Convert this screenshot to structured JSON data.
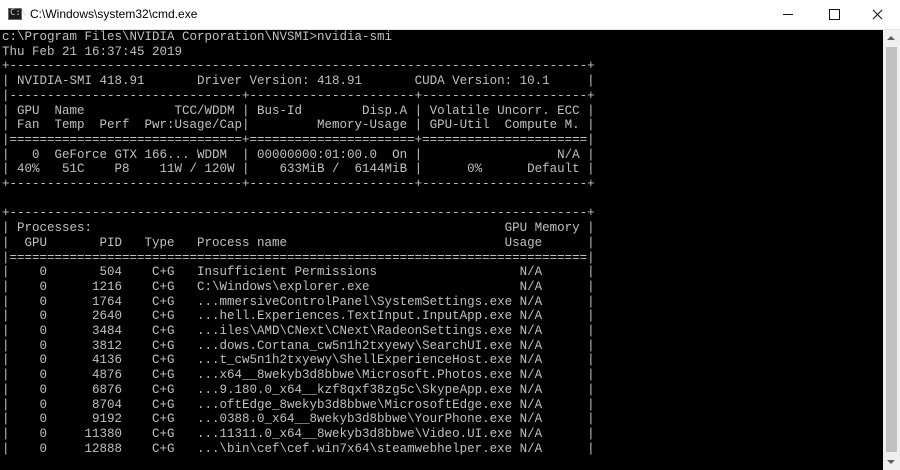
{
  "window": {
    "title": "C:\\Windows\\system32\\cmd.exe",
    "app_icon_glyph": "C:\\",
    "controls": [
      "minimize-icon",
      "maximize-icon",
      "close-icon"
    ]
  },
  "console": {
    "lines": [
      "c:\\Program Files\\NVIDIA Corporation\\NVSMI>nvidia-smi",
      "Thu Feb 21 16:37:45 2019",
      "+-----------------------------------------------------------------------------+",
      "| NVIDIA-SMI 418.91       Driver Version: 418.91       CUDA Version: 10.1     |",
      "|-------------------------------+----------------------+----------------------+",
      "| GPU  Name            TCC/WDDM | Bus-Id        Disp.A | Volatile Uncorr. ECC |",
      "| Fan  Temp  Perf  Pwr:Usage/Cap|         Memory-Usage | GPU-Util  Compute M. |",
      "|===============================+======================+======================|",
      "|   0  GeForce GTX 166... WDDM  | 00000000:01:00.0  On |                  N/A |",
      "| 40%   51C    P8    11W / 120W |    633MiB /  6144MiB |      0%      Default |",
      "+-------------------------------+----------------------+----------------------+",
      "",
      "+-----------------------------------------------------------------------------+",
      "| Processes:                                                       GPU Memory |",
      "|  GPU       PID   Type   Process name                             Usage      |",
      "|=============================================================================|",
      "|    0       504    C+G   Insufficient Permissions                   N/A      |",
      "|    0      1216    C+G   C:\\Windows\\explorer.exe                    N/A      |",
      "|    0      1764    C+G   ...mmersiveControlPanel\\SystemSettings.exe N/A      |",
      "|    0      2640    C+G   ...hell.Experiences.TextInput.InputApp.exe N/A      |",
      "|    0      3484    C+G   ...iles\\AMD\\CNext\\CNext\\RadeonSettings.exe N/A      |",
      "|    0      3812    C+G   ...dows.Cortana_cw5n1h2txyewy\\SearchUI.exe N/A      |",
      "|    0      4136    C+G   ...t_cw5n1h2txyewy\\ShellExperienceHost.exe N/A      |",
      "|    0      4876    C+G   ...x64__8wekyb3d8bbwe\\Microsoft.Photos.exe N/A      |",
      "|    0      6876    C+G   ...9.180.0_x64__kzf8qxf38zg5c\\SkypeApp.exe N/A      |",
      "|    0      8704    C+G   ...oftEdge_8wekyb3d8bbwe\\MicrosoftEdge.exe N/A      |",
      "|    0      9192    C+G   ...0388.0_x64__8wekyb3d8bbwe\\YourPhone.exe N/A      |",
      "|    0     11380    C+G   ...11311.0_x64__8wekyb3d8bbwe\\Video.UI.exe N/A      |",
      "|    0     12888    C+G   ...\\bin\\cef\\cef.win7x64\\steamwebhelper.exe N/A      |"
    ]
  }
}
